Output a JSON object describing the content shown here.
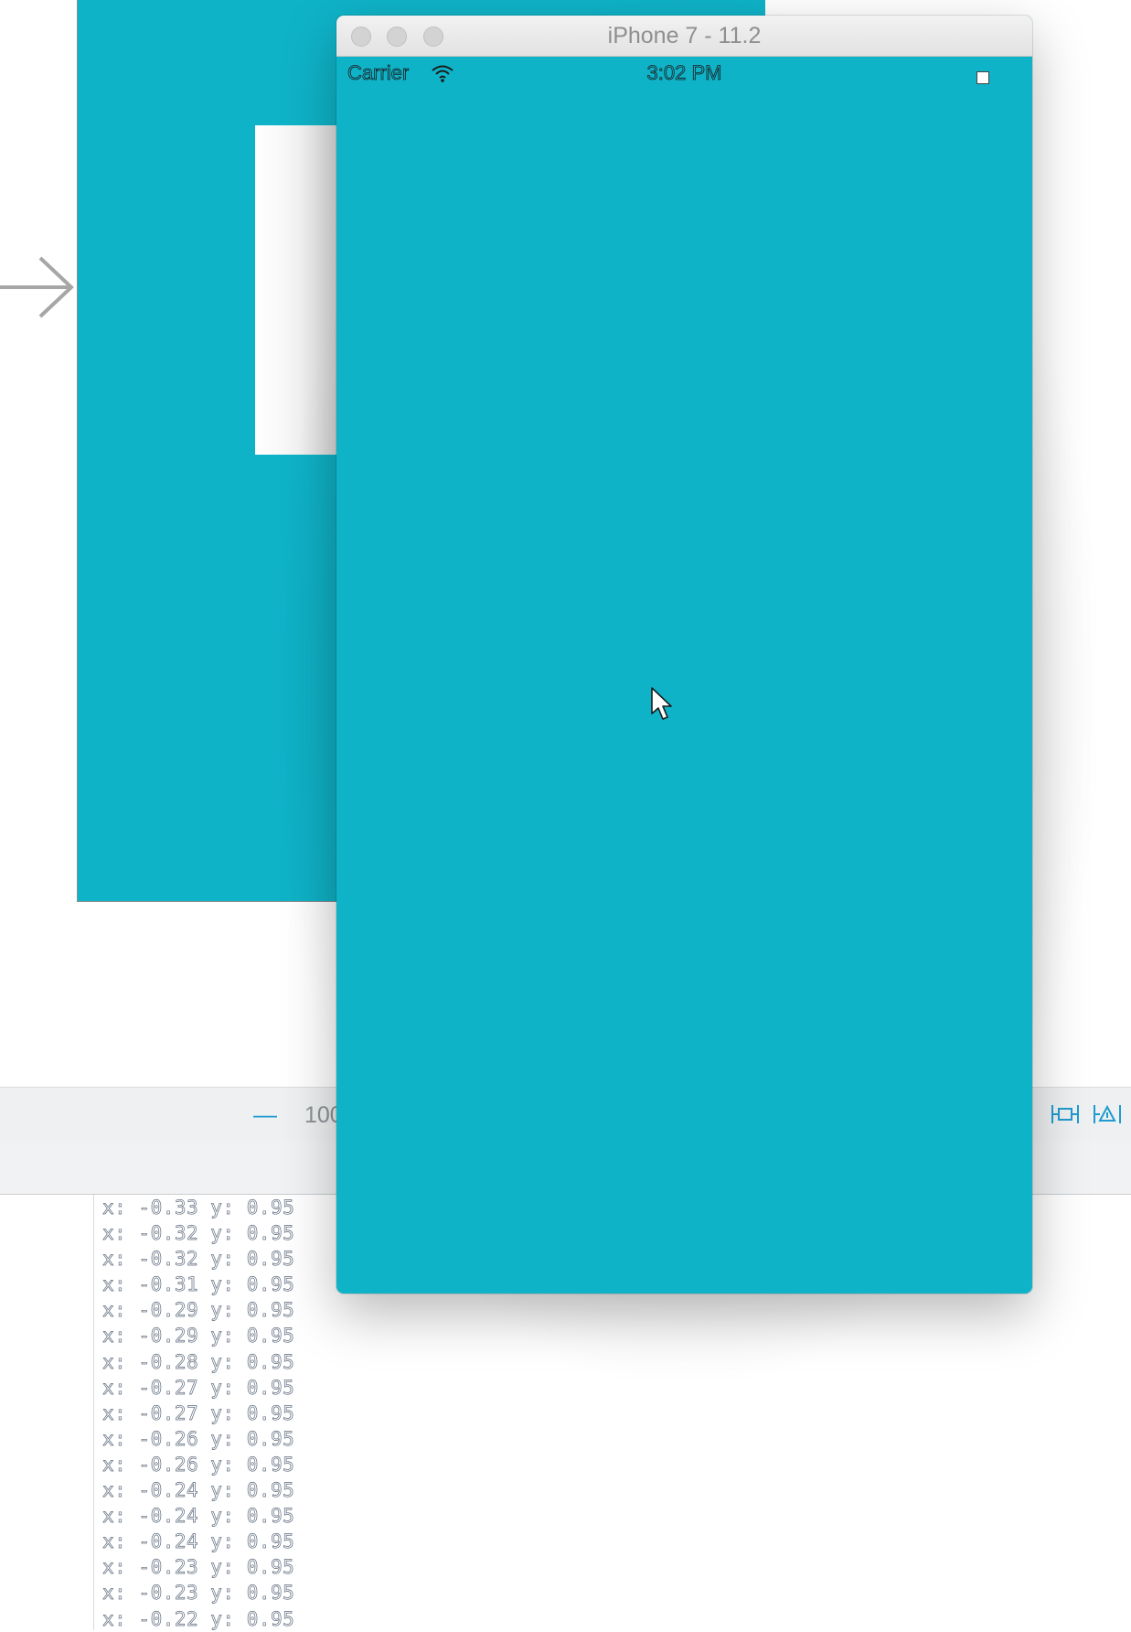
{
  "colors": {
    "accent": "#0fb3c8",
    "toolbar_blue": "#1f9bd0"
  },
  "simulator": {
    "title": "iPhone 7 - 11.2",
    "window_controls": [
      "close-button",
      "minimize-button",
      "zoom-button"
    ],
    "status_bar": {
      "carrier": "Carrier",
      "time": "3:02 PM",
      "icons": [
        "wifi-icon",
        "battery-icon"
      ]
    }
  },
  "canvas_toolbar": {
    "zoom_out": "—",
    "zoom_level": "100",
    "right_icons": [
      "update-frames-icon",
      "align-icon"
    ]
  },
  "console": {
    "lines": [
      "x: -0.33 y: 0.95",
      "x: -0.32 y: 0.95",
      "x: -0.32 y: 0.95",
      "x: -0.31 y: 0.95",
      "x: -0.29 y: 0.95",
      "x: -0.29 y: 0.95",
      "x: -0.28 y: 0.95",
      "x: -0.27 y: 0.95",
      "x: -0.27 y: 0.95",
      "x: -0.26 y: 0.95",
      "x: -0.26 y: 0.95",
      "x: -0.24 y: 0.95",
      "x: -0.24 y: 0.95",
      "x: -0.24 y: 0.95",
      "x: -0.23 y: 0.95",
      "x: -0.23 y: 0.95",
      "x: -0.22 y: 0.95"
    ]
  }
}
